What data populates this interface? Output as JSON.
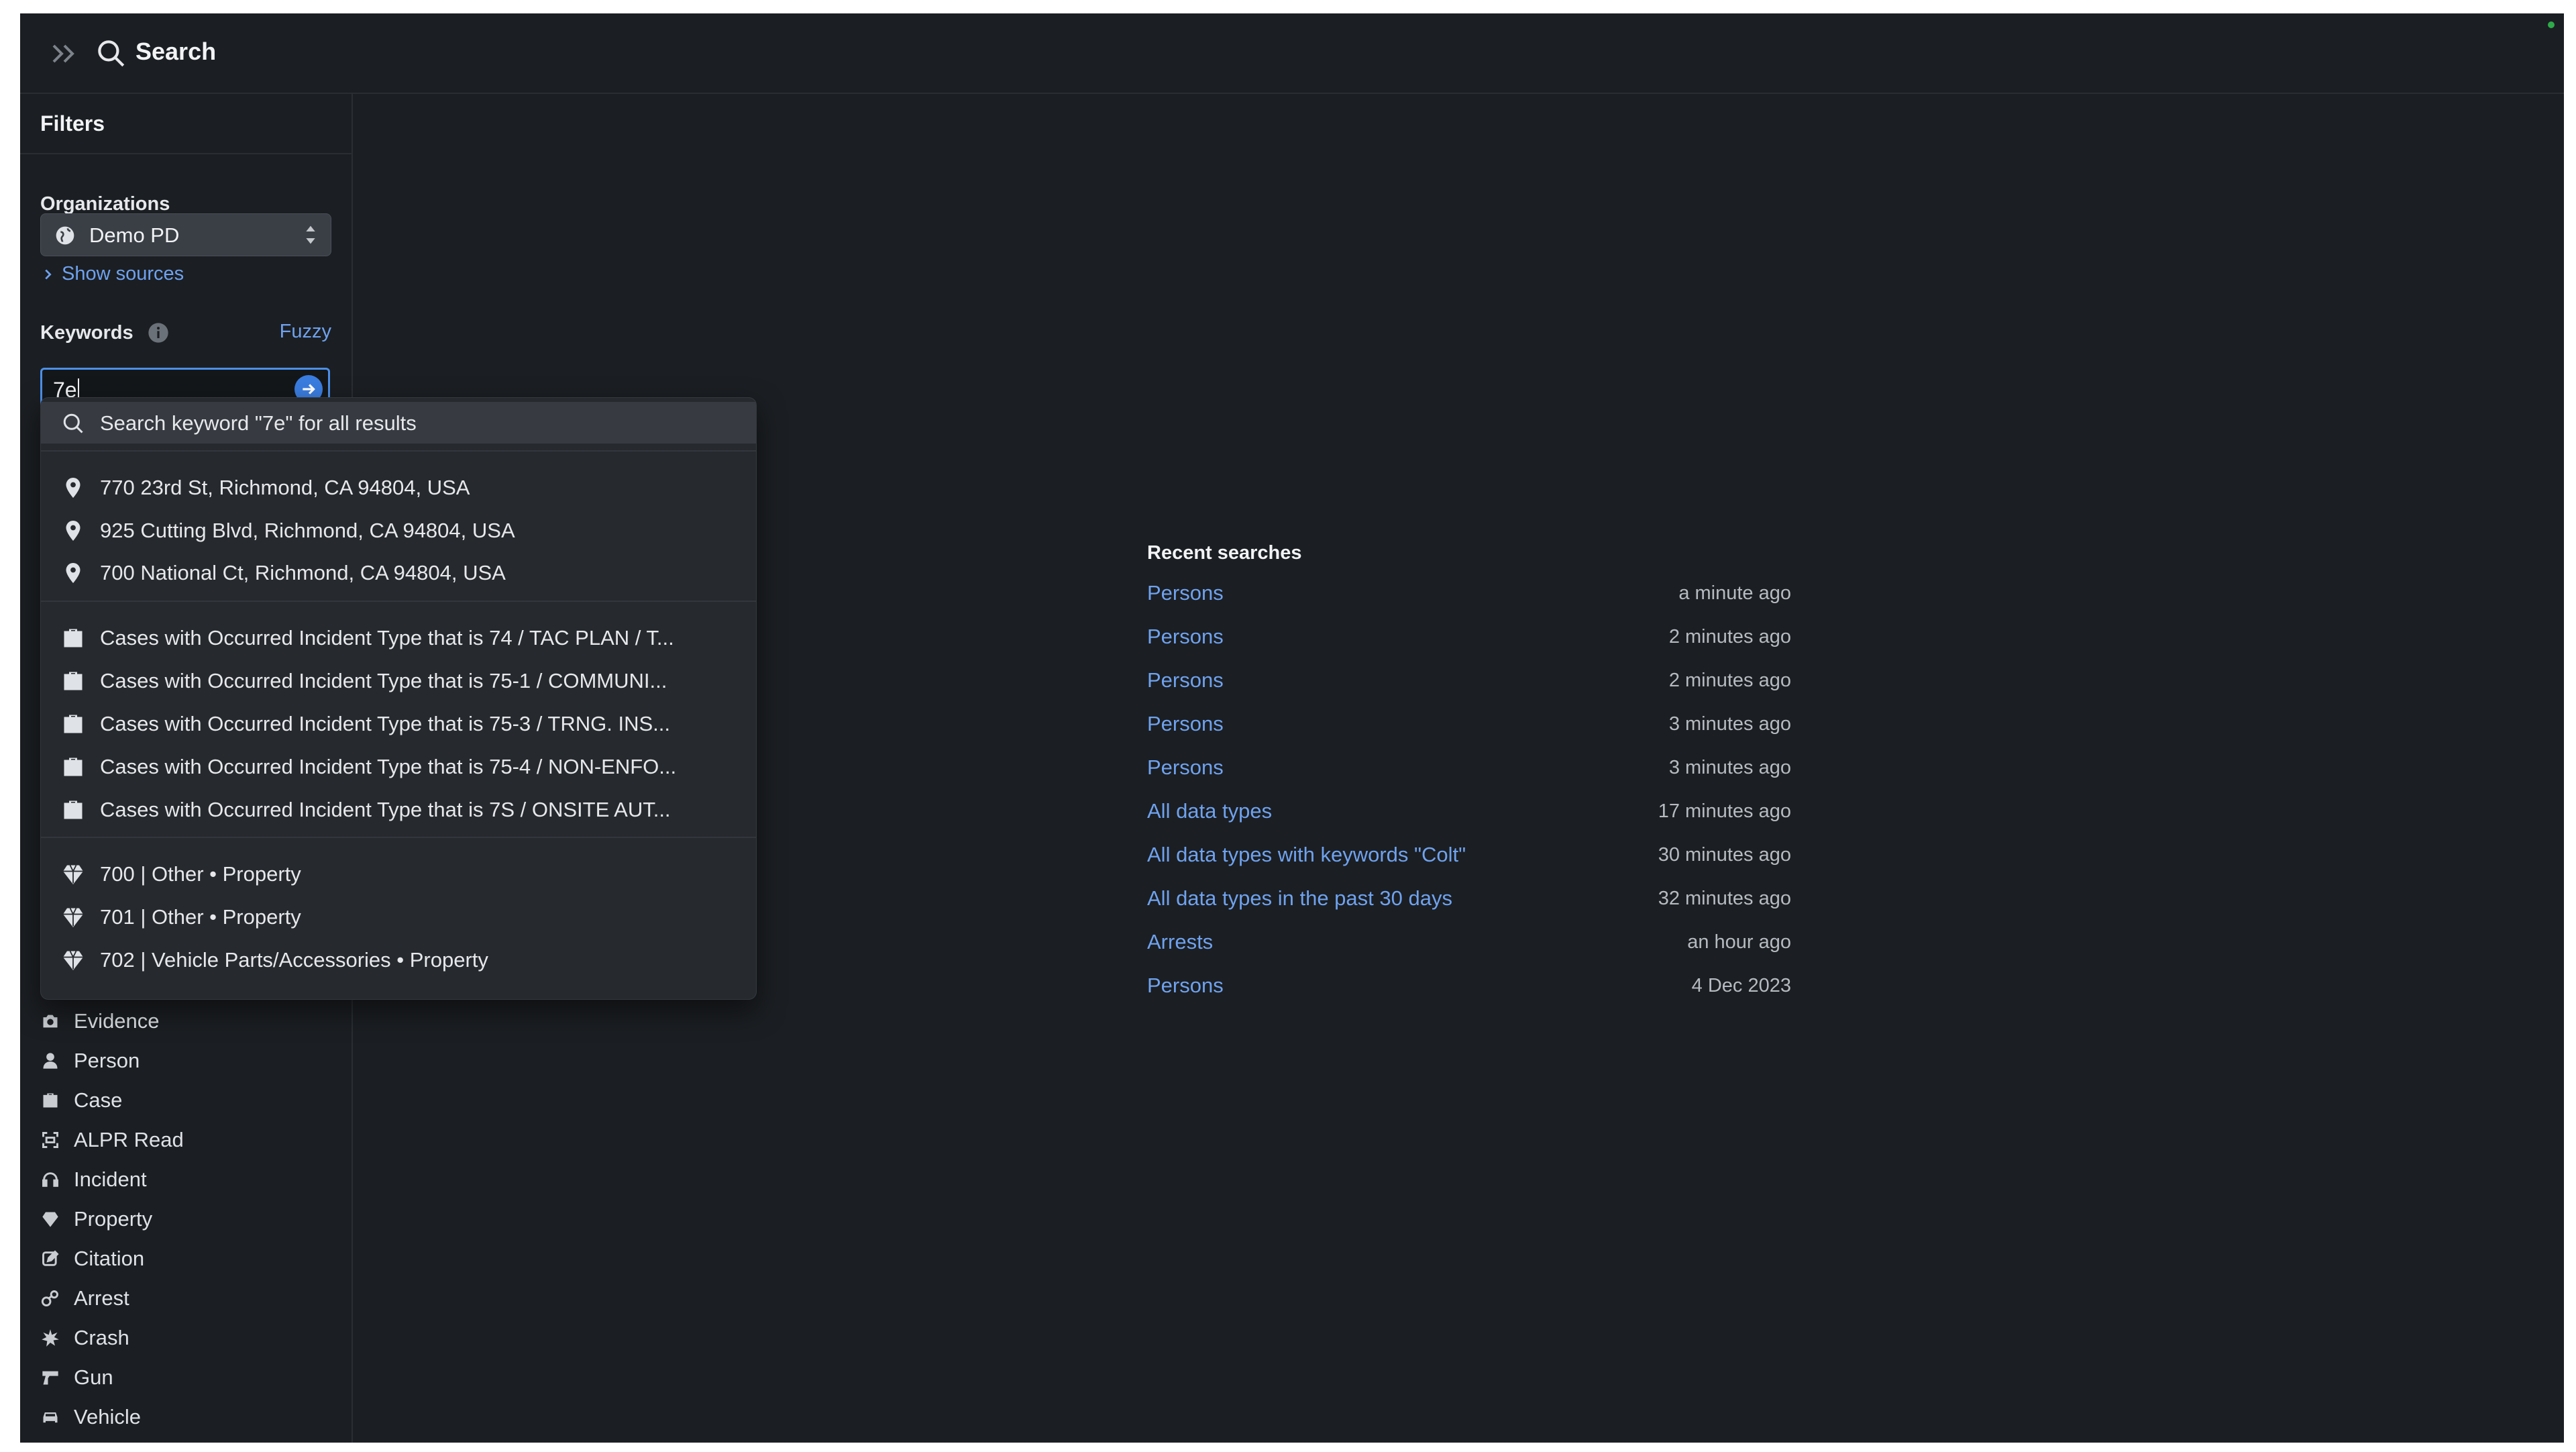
{
  "header": {
    "title": "Search"
  },
  "sidebar": {
    "filters_title": "Filters",
    "organizations_label": "Organizations",
    "organization_value": "Demo PD",
    "show_sources": "Show sources",
    "keywords_label": "Keywords",
    "fuzzy": "Fuzzy",
    "keyword_value": "7e",
    "data_types": [
      {
        "label": "Evidence",
        "icon": "camera-icon"
      },
      {
        "label": "Person",
        "icon": "person-icon"
      },
      {
        "label": "Case",
        "icon": "briefcase-icon"
      },
      {
        "label": "ALPR Read",
        "icon": "plate-scan-icon"
      },
      {
        "label": "Incident",
        "icon": "headset-icon"
      },
      {
        "label": "Property",
        "icon": "diamond-icon"
      },
      {
        "label": "Citation",
        "icon": "edit-icon"
      },
      {
        "label": "Arrest",
        "icon": "handcuffs-icon"
      },
      {
        "label": "Crash",
        "icon": "crash-icon"
      },
      {
        "label": "Gun",
        "icon": "gun-icon"
      },
      {
        "label": "Vehicle",
        "icon": "car-icon"
      }
    ]
  },
  "suggestions": {
    "keyword_search": "Search keyword \"7e\" for all results",
    "addresses": [
      "770 23rd St, Richmond, CA 94804, USA",
      "925 Cutting Blvd, Richmond, CA 94804, USA",
      "700 National Ct, Richmond, CA 94804, USA"
    ],
    "cases": [
      "Cases with Occurred Incident Type that is 74 / TAC PLAN / T...",
      "Cases with Occurred Incident Type that is 75-1 / COMMUNI...",
      "Cases with Occurred Incident Type that is 75-3 / TRNG. INS...",
      "Cases with Occurred Incident Type that is 75-4 / NON-ENFO...",
      "Cases with Occurred Incident Type that is 7S / ONSITE AUT..."
    ],
    "properties": [
      "700 | Other • Property",
      "701 | Other • Property",
      "702 | Vehicle Parts/Accessories • Property"
    ]
  },
  "recent": {
    "title": "Recent searches",
    "items": [
      {
        "label": "Persons",
        "time": "a minute ago"
      },
      {
        "label": "Persons",
        "time": "2 minutes ago"
      },
      {
        "label": "Persons",
        "time": "2 minutes ago"
      },
      {
        "label": "Persons",
        "time": "3 minutes ago"
      },
      {
        "label": "Persons",
        "time": "3 minutes ago"
      },
      {
        "label": "All data types",
        "time": "17 minutes ago"
      },
      {
        "label": "All data types with keywords \"Colt\"",
        "time": "30 minutes ago"
      },
      {
        "label": "All data types in the past 30 days",
        "time": "32 minutes ago"
      },
      {
        "label": "Arrests",
        "time": "an hour ago"
      },
      {
        "label": "Persons",
        "time": "4 Dec 2023"
      }
    ]
  }
}
